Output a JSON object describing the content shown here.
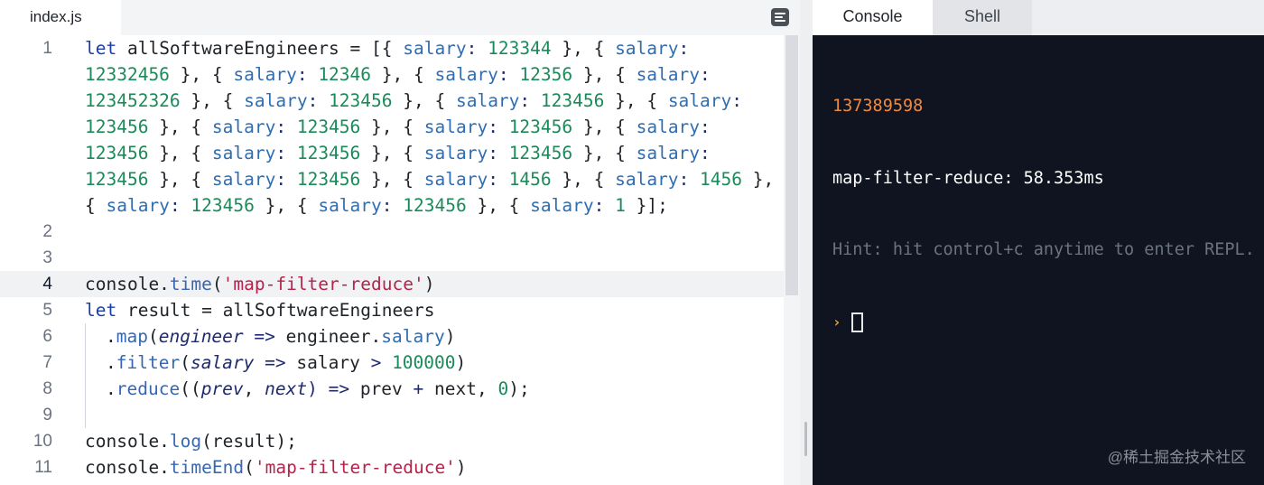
{
  "editor": {
    "tab_title": "index.js",
    "format_icon": "format-document-icon",
    "line_numbers": [
      "1",
      "2",
      "3",
      "4",
      "5",
      "6",
      "7",
      "8",
      "9",
      "10",
      "11"
    ],
    "active_line": "4"
  },
  "code": {
    "line1": {
      "row1": {
        "kw": "let",
        "name": " allSoftwareEngineers = [{ ",
        "p1": "salary",
        "c1": ": ",
        "n1": "123344",
        "s1": " }, { ",
        "p2": "salary",
        "c2": ":"
      },
      "row2": {
        "n1": "12332456",
        "s1": " }, { ",
        "p1": "salary",
        "c1": ": ",
        "n2": "12346",
        "s2": " }, { ",
        "p2": "salary",
        "c2": ": ",
        "n3": "12356",
        "s3": " }, { ",
        "p3": "salary",
        "c3": ":"
      },
      "row3": {
        "n1": "123452326",
        "s1": " }, { ",
        "p1": "salary",
        "c1": ": ",
        "n2": "123456",
        "s2": " }, { ",
        "p2": "salary",
        "c2": ": ",
        "n3": "123456",
        "s3": " }, { ",
        "p3": "salary",
        "c3": ":"
      },
      "row4": {
        "n1": "123456",
        "s1": " }, { ",
        "p1": "salary",
        "c1": ": ",
        "n2": "123456",
        "s2": " }, { ",
        "p2": "salary",
        "c2": ": ",
        "n3": "123456",
        "s3": " }, { ",
        "p3": "salary",
        "c3": ":"
      },
      "row5": {
        "n1": "123456",
        "s1": " }, { ",
        "p1": "salary",
        "c1": ": ",
        "n2": "123456",
        "s2": " }, { ",
        "p2": "salary",
        "c2": ": ",
        "n3": "123456",
        "s3": " }, { ",
        "p3": "salary",
        "c3": ":"
      },
      "row6": {
        "n1": "123456",
        "s1": " }, { ",
        "p1": "salary",
        "c1": ": ",
        "n2": "123456",
        "s2": " }, { ",
        "p2": "salary",
        "c2": ": ",
        "n3": "1456",
        "s3": " }, { ",
        "p3": "salary",
        "c3": ": ",
        "n4": "1456",
        "s4": " },"
      },
      "row7": {
        "s0": "{ ",
        "p1": "salary",
        "c1": ": ",
        "n1": "123456",
        "s1": " }, { ",
        "p2": "salary",
        "c2": ": ",
        "n2": "123456",
        "s2": " }, { ",
        "p3": "salary",
        "c3": ": ",
        "n3": "1",
        "s3": " }];"
      }
    },
    "line4": {
      "obj": "console.",
      "method": "time",
      "open": "(",
      "str": "'map-filter-reduce'",
      "close": ")"
    },
    "line5": {
      "kw": "let",
      "rest": " result = allSoftwareEngineers"
    },
    "line6": {
      "dot": ".",
      "method": "map",
      "open": "(",
      "param": "engineer",
      "arrow": " => ",
      "obj": "engineer.",
      "prop": "salary",
      "close": ")"
    },
    "line7": {
      "dot": ".",
      "method": "filter",
      "open": "(",
      "param": "salary",
      "arrow": " => ",
      "obj": "salary ",
      "gt": ">",
      "sp": " ",
      "num": "100000",
      "close": ")"
    },
    "line8": {
      "dot": ".",
      "method": "reduce",
      "open": "((",
      "param1": "prev",
      "comma": ", ",
      "param2": "next",
      "arrow": ") => ",
      "a": "prev ",
      "plus": "+",
      "b": " next, ",
      "num": "0",
      "close": ");"
    },
    "line10": {
      "obj": "console.",
      "method": "log",
      "rest": "(result);"
    },
    "line11": {
      "obj": "console.",
      "method": "timeEnd",
      "open": "(",
      "str": "'map-filter-reduce'",
      "close": ")"
    }
  },
  "console": {
    "tabs": {
      "console": "Console",
      "shell": "Shell"
    },
    "output": {
      "result": "137389598",
      "timer": "map-filter-reduce: 58.353ms",
      "hint": "Hint: hit control+c anytime to enter REPL."
    },
    "prompt": "›",
    "watermark": "@稀土掘金技术社区"
  },
  "colors": {
    "keyword": "#1a3ea6",
    "number": "#1b8a5a",
    "string": "#b5234b",
    "console_bg": "#0f1420",
    "console_result": "#f08a3e"
  }
}
